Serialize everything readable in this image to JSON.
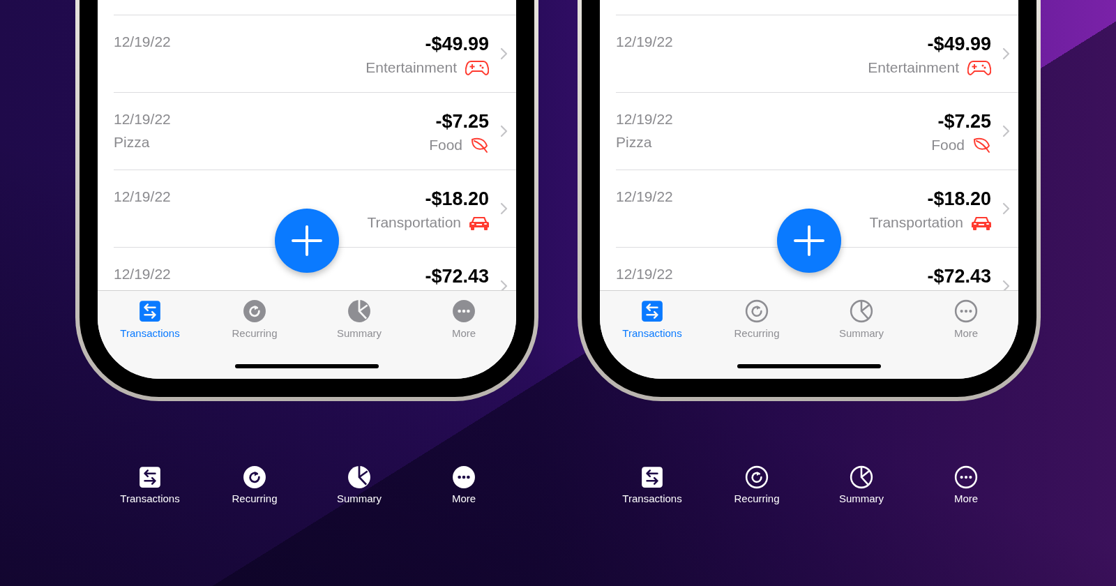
{
  "phones": [
    {
      "kind": "filled",
      "transactions": [
        {
          "date": "12/19/22",
          "amount": "-$49.99",
          "category": "Entertainment",
          "kind": "entertainment"
        },
        {
          "date": "12/19/22",
          "note": "Pizza",
          "amount": "-$7.25",
          "category": "Food",
          "kind": "food"
        },
        {
          "date": "12/19/22",
          "amount": "-$18.20",
          "category": "Transportation",
          "kind": "transportation"
        },
        {
          "date": "12/19/22",
          "amount": "-$72.43"
        }
      ],
      "tabs": [
        {
          "label": "Transactions",
          "kind": "transactions",
          "selected": true
        },
        {
          "label": "Recurring",
          "kind": "recurring",
          "selected": false
        },
        {
          "label": "Summary",
          "kind": "summary",
          "selected": false
        },
        {
          "label": "More",
          "kind": "more",
          "selected": false
        }
      ]
    },
    {
      "kind": "outline",
      "transactions": [
        {
          "date": "12/19/22",
          "amount": "-$49.99",
          "category": "Entertainment",
          "kind": "entertainment"
        },
        {
          "date": "12/19/22",
          "note": "Pizza",
          "amount": "-$7.25",
          "category": "Food",
          "kind": "food"
        },
        {
          "date": "12/19/22",
          "amount": "-$18.20",
          "category": "Transportation",
          "kind": "transportation"
        },
        {
          "date": "12/19/22",
          "amount": "-$72.43"
        }
      ],
      "tabs": [
        {
          "label": "Transactions",
          "kind": "transactions",
          "selected": true
        },
        {
          "label": "Recurring",
          "kind": "recurring",
          "selected": false
        },
        {
          "label": "Summary",
          "kind": "summary",
          "selected": false
        },
        {
          "label": "More",
          "kind": "more",
          "selected": false
        }
      ]
    }
  ],
  "legends": [
    {
      "kind": "filled",
      "items": [
        {
          "label": "Transactions",
          "kind": "transactions"
        },
        {
          "label": "Recurring",
          "kind": "recurring"
        },
        {
          "label": "Summary",
          "kind": "summary"
        },
        {
          "label": "More",
          "kind": "more"
        }
      ]
    },
    {
      "kind": "outline",
      "items": [
        {
          "label": "Transactions",
          "kind": "transactions"
        },
        {
          "label": "Recurring",
          "kind": "recurring"
        },
        {
          "label": "Summary",
          "kind": "summary"
        },
        {
          "label": "More",
          "kind": "more"
        }
      ]
    }
  ]
}
